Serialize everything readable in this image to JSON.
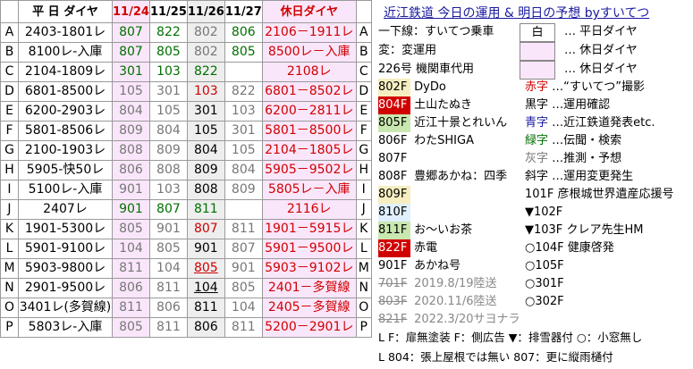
{
  "header": {
    "weekday_label": "平 日 ダイヤ",
    "dates": [
      "11/24",
      "11/25",
      "11/26",
      "11/27"
    ],
    "holiday_label": "休日ダイヤ"
  },
  "rows": [
    {
      "letter": "A",
      "weekday": "2403-1801レ",
      "d1": "807",
      "d2": "822",
      "d3": "802",
      "d4": "806",
      "holiday": "2106－1911レ"
    },
    {
      "letter": "B",
      "weekday": "8100レ-入庫",
      "d1": "807",
      "d2": "805",
      "d3": "802",
      "d4": "805",
      "holiday": "8500レ－入庫"
    },
    {
      "letter": "C",
      "weekday": "2104-1809レ",
      "d1": "301",
      "d2": "103",
      "d3": "822",
      "d4": "",
      "holiday": "2108レ"
    },
    {
      "letter": "D",
      "weekday": "6801-8500レ",
      "d1": "105",
      "d2": "301",
      "d3": "103",
      "d4": "822",
      "holiday": "6801－8502レ"
    },
    {
      "letter": "E",
      "weekday": "6200-2903レ",
      "d1": "804",
      "d2": "105",
      "d3": "301",
      "d4": "103",
      "holiday": "6200－2811レ"
    },
    {
      "letter": "F",
      "weekday": "5801-8506レ",
      "d1": "809",
      "d2": "804",
      "d3": "105",
      "d4": "301",
      "holiday": "5801－8500レ"
    },
    {
      "letter": "G",
      "weekday": "2100-1903レ",
      "d1": "808",
      "d2": "809",
      "d3": "804",
      "d4": "105",
      "holiday": "2104－1805レ"
    },
    {
      "letter": "H",
      "weekday": "5905-快50レ",
      "d1": "806",
      "d2": "808",
      "d3": "809",
      "d4": "804",
      "holiday": "5905－9502レ"
    },
    {
      "letter": "I",
      "weekday": "5100レ-入庫",
      "d1": "901",
      "d2": "103",
      "d3": "808",
      "d4": "809",
      "holiday": "5805レ－入庫"
    },
    {
      "letter": "J",
      "weekday": "2407レ",
      "d1": "901",
      "d2": "807",
      "d3": "811",
      "d4": "",
      "holiday": "2116レ"
    },
    {
      "letter": "K",
      "weekday": "1901-5300レ",
      "d1": "805",
      "d2": "901",
      "d3": "807",
      "d4": "811",
      "holiday": "1901－5915レ"
    },
    {
      "letter": "L",
      "weekday": "5901-9100レ",
      "d1": "104",
      "d2": "805",
      "d3": "901",
      "d4": "807",
      "holiday": "5901－9500レ"
    },
    {
      "letter": "M",
      "weekday": "5903-9800レ",
      "d1": "811",
      "d2": "104",
      "d3": "805",
      "d4": "901",
      "holiday": "5903－9102レ"
    },
    {
      "letter": "N",
      "weekday": "2901-9500レ",
      "d1": "806",
      "d2": "811",
      "d3": "104",
      "d4": "805",
      "holiday": "2401－多賀線"
    },
    {
      "letter": "O",
      "weekday": "3401レ(多賀線)",
      "d1": "811",
      "d2": "806",
      "d3": "811",
      "d4": "104",
      "holiday": "2405－多賀線"
    },
    {
      "letter": "P",
      "weekday": "5803レ-入庫",
      "d1": "805",
      "d2": "811",
      "d3": "806",
      "d4": "811",
      "holiday": "5200－2901レ"
    }
  ],
  "legend": {
    "title": "近江鉄道 今日の運用 & 明日の予想",
    "author": "byすいてつ",
    "items": [
      {
        "left": "一下線：すいてつ乗車",
        "box": "白",
        "right": "… 平日ダイヤ"
      },
      {
        "left": "変：変運用",
        "box": "",
        "right": "… 休日ダイヤ"
      },
      {
        "left": "226号 機関車代用",
        "box": "",
        "right": "… 休日ダイヤ"
      }
    ],
    "cars": [
      {
        "num": "802F",
        "name": "DyDo",
        "tag": "赤字",
        "desc": "…“すいてつ”撮影"
      },
      {
        "num": "804F",
        "name": "土山たぬき",
        "tag": "黒字",
        "desc": "…運用確認"
      },
      {
        "num": "805F",
        "name": "近江十景とれいん",
        "tag": "青字",
        "desc": "…近江鉄道発表etc."
      },
      {
        "num": "806F",
        "name": "わたSHIGA",
        "tag": "緑字",
        "desc": "…伝聞・検索"
      },
      {
        "num": "807F",
        "name": "",
        "tag": "灰字",
        "desc": "…推測・予想"
      },
      {
        "num": "808F",
        "name": "豊郷あかね：四季",
        "tag": "斜字",
        "desc": "…運用変更発生"
      },
      {
        "num": "809F",
        "name": "",
        "tag": "101F",
        "desc": "彦根城世界遺産応援号"
      },
      {
        "num": "810F",
        "name": "",
        "tag": "▼102F",
        "desc": ""
      },
      {
        "num": "811F",
        "name": "お〜いお茶",
        "tag": "▼103F",
        "desc": "クレア先生HM"
      },
      {
        "num": "822F",
        "name": "赤電",
        "tag": "○104F",
        "desc": "健康啓発"
      },
      {
        "num": "901F",
        "name": "あかね号",
        "tag": "○105F",
        "desc": ""
      },
      {
        "num": "701F",
        "name": "2019.8/19陸送",
        "tag": "○301F",
        "desc": ""
      },
      {
        "num": "803F",
        "name": "2020.11/6陸送",
        "tag": "○302F",
        "desc": ""
      },
      {
        "num": "821F",
        "name": "2022.3/20サヨナラ",
        "tag": "",
        "desc": ""
      }
    ],
    "notes": [
      "L F：扉無塗装 F：側広告 ▼：排雪器付 ○：小窓無し",
      "L 804：張上屋根では無い 807：更に縦雨樋付"
    ]
  },
  "colors": {
    "pink": "#fae6fa",
    "red": "#d00000",
    "green": "#007000",
    "gray": "#777777",
    "blue": "#1a1aa0"
  }
}
